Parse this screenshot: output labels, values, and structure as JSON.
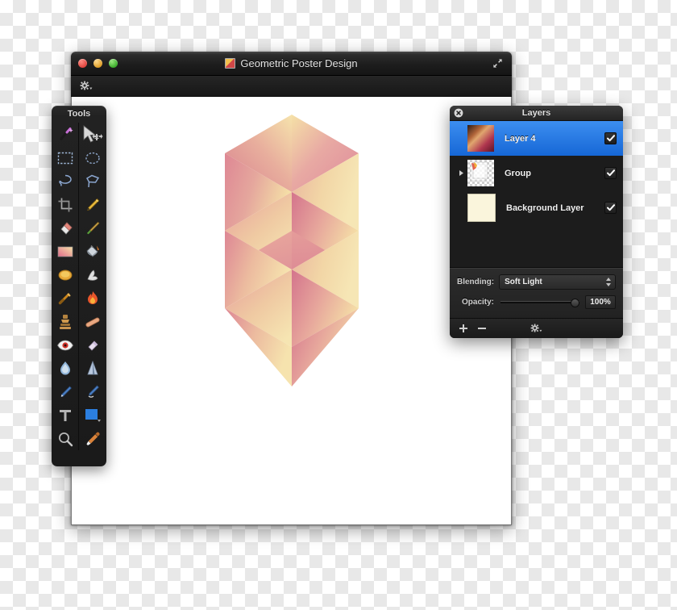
{
  "window": {
    "title": "Geometric Poster Design",
    "doc_icon": "document-image-icon",
    "traffic_lights": [
      "close-button",
      "minimize-button",
      "zoom-button"
    ],
    "expand_icon": "expand-arrows-icon",
    "toolbar": {
      "gear_icon": "gear-dropdown-icon"
    }
  },
  "tools_palette": {
    "title": "Tools",
    "tools": [
      {
        "name": "magic-wand-tool"
      },
      {
        "name": "move-arrow-tool"
      },
      {
        "name": "rectangular-marquee-tool"
      },
      {
        "name": "elliptical-marquee-tool"
      },
      {
        "name": "lasso-tool"
      },
      {
        "name": "polygonal-lasso-tool"
      },
      {
        "name": "crop-tool"
      },
      {
        "name": "pencil-tool"
      },
      {
        "name": "eraser-tool"
      },
      {
        "name": "paintbrush-tool"
      },
      {
        "name": "gradient-tool"
      },
      {
        "name": "paint-bucket-tool"
      },
      {
        "name": "dodge-tool"
      },
      {
        "name": "smudge-tool"
      },
      {
        "name": "blur-tool"
      },
      {
        "name": "burn-tool"
      },
      {
        "name": "clone-stamp-tool"
      },
      {
        "name": "healing-brush-tool"
      },
      {
        "name": "red-eye-tool"
      },
      {
        "name": "sharpen-tool"
      },
      {
        "name": "water-drop-tool"
      },
      {
        "name": "cone-shape-tool"
      },
      {
        "name": "pen-tool"
      },
      {
        "name": "freeform-pen-tool"
      },
      {
        "name": "text-tool"
      },
      {
        "name": "shape-rectangle-tool"
      },
      {
        "name": "zoom-tool"
      },
      {
        "name": "eyedropper-tool"
      }
    ]
  },
  "layers_panel": {
    "title": "Layers",
    "close_icon": "close-circle-icon",
    "layers": [
      {
        "name": "Layer 4",
        "thumb": "gradient-thumbnail",
        "visible": true,
        "selected": true,
        "has_disclosure": false
      },
      {
        "name": "Group",
        "thumb": "group-stack-thumbnail",
        "visible": true,
        "selected": false,
        "has_disclosure": true
      },
      {
        "name": "Background Layer",
        "thumb": "cream-thumbnail",
        "visible": true,
        "selected": false,
        "has_disclosure": false
      }
    ],
    "blending": {
      "label": "Blending:",
      "value": "Soft Light"
    },
    "opacity": {
      "label": "Opacity:",
      "value": "100%",
      "percent": 100
    },
    "footer": {
      "add_icon": "plus-icon",
      "remove_icon": "minus-icon",
      "gear_icon": "gear-dropdown-icon"
    }
  },
  "artwork": {
    "name": "isometric-cube-illustration",
    "colors": {
      "pink": "#DC8C96",
      "pink_deep": "#D4758C",
      "yellow": "#F5DFA5",
      "yellow_light": "#F7E6B8",
      "peach": "#EFBE96"
    }
  }
}
